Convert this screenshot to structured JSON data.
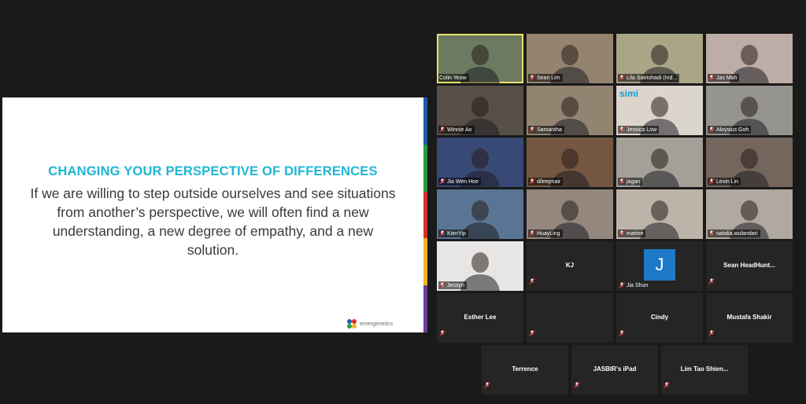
{
  "slide": {
    "heading": "CHANGING YOUR PERSPECTIVE OF DIFFERENCES",
    "body": "If we are willing to step outside ourselves and see situations from another’s perspective, we will often find a new understanding, a new degree of empathy, and a new solution.",
    "logo_text": "emergenetics",
    "stripe_colors": [
      "#1f5aa8",
      "#2a9b3d",
      "#d6312b",
      "#f2b321",
      "#6a3d98"
    ]
  },
  "gallery": {
    "participants": [
      {
        "name": "Colin Yeow",
        "type": "video",
        "bg": "#5f6f54",
        "active": true,
        "muted": false
      },
      {
        "name": "Sean Lim",
        "type": "video",
        "bg": "#8b7a63",
        "muted": true
      },
      {
        "name": "Lila Satriohadi (Ind...",
        "type": "video",
        "bg": "#a49e7e",
        "muted": true
      },
      {
        "name": "Jas Mah",
        "type": "video",
        "bg": "#b9a79f",
        "muted": true
      },
      {
        "name": "Winnie Ao",
        "type": "video",
        "bg": "#4a4038",
        "muted": true
      },
      {
        "name": "Samantha",
        "type": "video",
        "bg": "#8a7a66",
        "muted": true
      },
      {
        "name": "Jessica Low",
        "type": "video",
        "bg": "#d8d2c8",
        "muted": true,
        "logo": "simi"
      },
      {
        "name": "Aloysius Goh",
        "type": "video",
        "bg": "#8e8b86",
        "muted": true
      },
      {
        "name": "Jia Wen Hoe",
        "type": "video",
        "bg": "#283a6a",
        "muted": true
      },
      {
        "name": "dileepnair",
        "type": "video",
        "bg": "#6b4a32",
        "muted": true
      },
      {
        "name": "jagan",
        "type": "video",
        "bg": "#9c9890",
        "muted": true
      },
      {
        "name": "Levin Lin",
        "type": "video",
        "bg": "#6a5a50",
        "muted": true
      },
      {
        "name": "KienYip",
        "type": "video",
        "bg": "#4d6a8a",
        "muted": true
      },
      {
        "name": "HuayLing",
        "type": "video",
        "bg": "#8a7d74",
        "muted": true
      },
      {
        "name": "marine",
        "type": "video",
        "bg": "#b8aea2",
        "muted": true
      },
      {
        "name": "natalia.wulandari",
        "type": "video",
        "bg": "#aaa29a",
        "muted": true
      },
      {
        "name": "Jessyn",
        "type": "video",
        "bg": "#e6e4e2",
        "muted": true
      },
      {
        "name": "KJ",
        "type": "name",
        "muted": true
      },
      {
        "name": "Jia Shun",
        "type": "avatar",
        "avatar_letter": "J",
        "muted": true
      },
      {
        "name": "Sean  HeadHunt...",
        "type": "name",
        "muted": true
      },
      {
        "name": "Esther Lee",
        "type": "name",
        "muted": true
      },
      {
        "name": "",
        "type": "name",
        "muted": true
      },
      {
        "name": "Cindy",
        "type": "name",
        "muted": true
      },
      {
        "name": "Mustafa Shakir",
        "type": "name",
        "muted": true
      },
      {
        "name": "Terrence",
        "type": "name",
        "muted": true
      },
      {
        "name": "JASBIR’s iPad",
        "type": "name",
        "muted": true
      },
      {
        "name": "Lim  Tao Shien...",
        "type": "name",
        "muted": true
      }
    ]
  }
}
